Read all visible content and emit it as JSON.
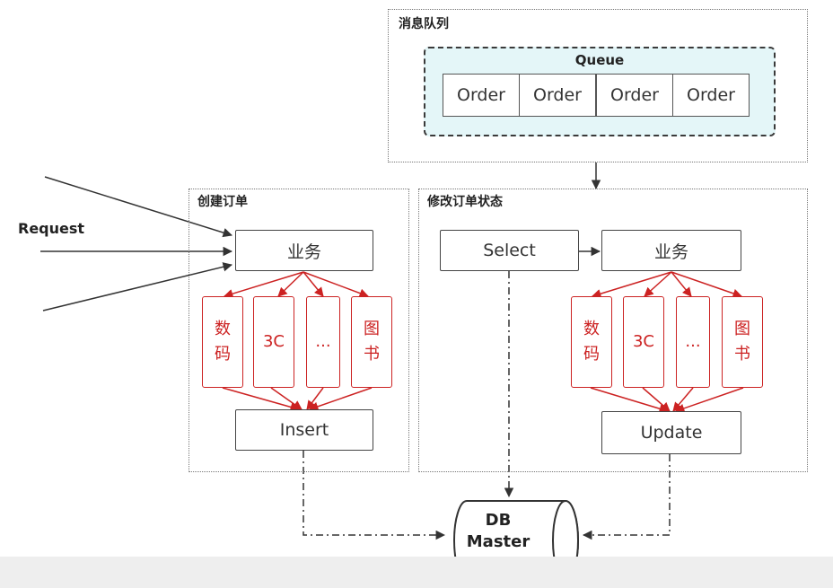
{
  "queue_group": {
    "title": "消息队列",
    "queue_label": "Queue",
    "orders": [
      "Order",
      "Order",
      "Order",
      "Order"
    ]
  },
  "request_label": "Request",
  "create_group": {
    "title": "创建订单",
    "business": "业务",
    "categories": [
      "数码",
      "3C",
      "...",
      "图书"
    ],
    "insert": "Insert"
  },
  "modify_group": {
    "title": "修改订单状态",
    "select": "Select",
    "business": "业务",
    "categories": [
      "数码",
      "3C",
      "...",
      "图书"
    ],
    "update": "Update"
  },
  "db": {
    "line1": "DB",
    "line2": "Master"
  },
  "colors": {
    "queue_fill": "#e4f6f8",
    "category_red": "#c22222"
  }
}
